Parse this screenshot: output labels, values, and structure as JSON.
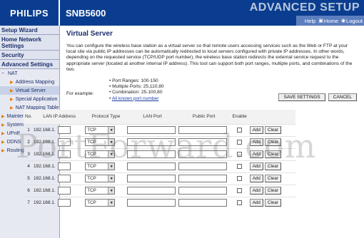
{
  "header": {
    "brand": "PHILIPS",
    "model": "SNB5600",
    "title": "ADVANCED SETUP",
    "tools": [
      {
        "icon": "help-icon",
        "label": "Help"
      },
      {
        "icon": "home-icon",
        "label": "Home"
      },
      {
        "icon": "logout-icon",
        "label": "Logout"
      }
    ]
  },
  "sidebar": {
    "setup_wizard": "Setup Wizard",
    "home_network": "Home Network Settings",
    "security": "Security",
    "advanced": "Advanced Settings",
    "nat": "NAT",
    "nat_items": [
      "Address Mapping",
      "Virtual Server",
      "Special Application",
      "NAT Mapping Table"
    ],
    "other_items": [
      "Maintenance",
      "System",
      "UPnP",
      "DDNS",
      "Routing"
    ]
  },
  "main": {
    "title": "Virtual Server",
    "description": "You can configure the wireless base station as a virtual server so that remote users accessing services such as the Web or FTP at your local site via public IP addresses can be automatically redirected to local servers configured with private IP addresses. In other words, depending on the requested service (TCP/UDP port number), the wireless base station redirects the external service request to the appropriate server (located at another internal IP address). This tool can support both port ranges, multiple ports, and combinations of the two.",
    "example_label": "For example:",
    "examples": [
      "Port Ranges: 100-150",
      "Multiple Ports: 25,110,80",
      "Combination: 25-100,80"
    ],
    "all_ports_link": "All known port number",
    "save_label": "SAVE SETTINGS",
    "cancel_label": "CANCEL",
    "columns": {
      "no": "No.",
      "ip": "LAN IP Address",
      "protocol": "Protocol Type",
      "lan_port": "LAN Port",
      "public_port": "Public Port",
      "enable": "Enable"
    },
    "rows": [
      {
        "no": "1",
        "ip": "192.168.1.",
        "protocol": "TCP"
      },
      {
        "no": "2",
        "ip": "192.168.1.",
        "protocol": "TCP"
      },
      {
        "no": "3",
        "ip": "192.168.1.",
        "protocol": "TCP"
      },
      {
        "no": "4",
        "ip": "192.168.1.",
        "protocol": "TCP"
      },
      {
        "no": "5",
        "ip": "192.168.1.",
        "protocol": "TCP"
      },
      {
        "no": "6",
        "ip": "192.168.1.",
        "protocol": "TCP"
      },
      {
        "no": "7",
        "ip": "192.168.1.",
        "protocol": "TCP"
      }
    ],
    "add_label": "Add",
    "clear_label": "Clear"
  },
  "watermark": "PortForward.com",
  "colors": {
    "header_bg": "#0a3d8f",
    "toolbar_bg": "#5d7fbf",
    "sidebar_bg": "#e7e9f2",
    "title_blue": "#1b2f6a"
  }
}
